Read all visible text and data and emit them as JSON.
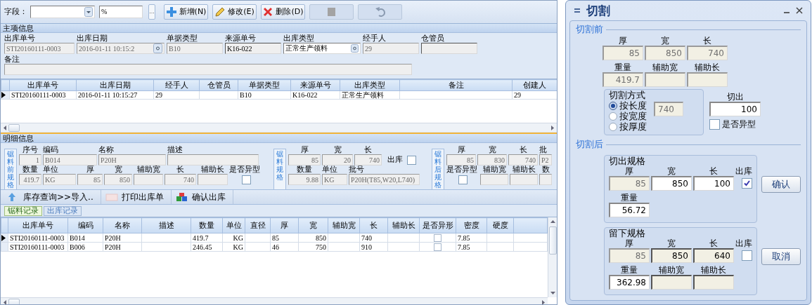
{
  "toolbar": {
    "label": "字段：",
    "filter_value": "%",
    "browse_button": "...",
    "buttons": [
      {
        "kind": "add",
        "label": "新增(N)",
        "disabled": false
      },
      {
        "kind": "edit",
        "label": "修改(E)",
        "disabled": false
      },
      {
        "kind": "delete",
        "label": "删除(D)",
        "disabled": false
      },
      {
        "kind": "save",
        "disabled": true
      },
      {
        "kind": "undo",
        "disabled": true
      }
    ]
  },
  "main_info": {
    "title": "主项信息",
    "fields": [
      {
        "label": "出库单号",
        "value": "STI20160111-0003",
        "kind": "text",
        "disabled": true,
        "editable": false
      },
      {
        "label": "出库日期",
        "value": "2016-01-11 10:15:2",
        "kind": "date",
        "disabled": true,
        "editable": false
      },
      {
        "label": "单据类型",
        "value": "B10",
        "kind": "text",
        "disabled": true,
        "editable": false
      },
      {
        "label": "来源单号",
        "value": "K16-022",
        "kind": "text",
        "disabled": false,
        "editable": false
      },
      {
        "label": "出库类型",
        "value": "正常生产领料",
        "kind": "combo",
        "disabled": false,
        "editable": true
      },
      {
        "label": "经手人",
        "value": "29",
        "kind": "text",
        "disabled": true,
        "editable": false
      },
      {
        "label": "仓管员",
        "kind": "text",
        "disabled": false,
        "editable": false
      }
    ],
    "remark": {
      "label": "备注",
      "kind": "text",
      "disabled": true,
      "editable": false
    }
  },
  "main_table": {
    "columns": [
      "出库单号",
      "出库日期",
      "经手人",
      "仓管员",
      "单据类型",
      "来源单号",
      "出库类型",
      "备注",
      "创建人"
    ],
    "rows": [
      {
        "selected": true,
        "cells": [
          "STI20160111-0003",
          "2016-01-11 10:15:27",
          "29",
          null,
          "B10",
          "K16-022",
          "正常生产领料",
          null,
          "29"
        ]
      }
    ]
  },
  "detail": {
    "title": "明细信息",
    "groups": [
      {
        "title": "锯料前规格",
        "fields": [
          {
            "label": "序号",
            "value": "1",
            "kind": "number",
            "disabled": true,
            "editable": false
          },
          {
            "label": "编码",
            "value": "B014",
            "kind": "text",
            "disabled": true,
            "editable": false
          },
          {
            "label": "名称",
            "value": "P20H",
            "kind": "text",
            "disabled": true,
            "editable": false
          },
          {
            "label": "描述",
            "kind": "text",
            "disabled": true,
            "editable": false
          },
          {
            "label": "数量",
            "value": "419.7",
            "kind": "number",
            "disabled": true,
            "editable": false
          },
          {
            "label": "单位",
            "value": "KG",
            "kind": "text",
            "disabled": true,
            "editable": false
          },
          {
            "label": "厚",
            "value": "85",
            "kind": "number",
            "disabled": true,
            "editable": false
          },
          {
            "label": "宽",
            "value": "850",
            "kind": "number",
            "disabled": true,
            "editable": false
          },
          {
            "label": "辅助宽",
            "kind": "number",
            "disabled": true,
            "editable": false
          },
          {
            "label": "长",
            "value": "740",
            "kind": "number",
            "disabled": true,
            "editable": false
          },
          {
            "label": "辅助长",
            "kind": "number",
            "disabled": true,
            "editable": false
          },
          {
            "label": "是否异型",
            "kind": "check",
            "checked": false
          }
        ]
      },
      {
        "title": "锯料规格",
        "fields": [
          {
            "label": "厚",
            "value": "85",
            "kind": "number",
            "disabled": true,
            "editable": false
          },
          {
            "label": "宽",
            "value": "20",
            "kind": "number",
            "disabled": true,
            "editable": false
          },
          {
            "label": "长",
            "value": "740",
            "kind": "number",
            "disabled": true,
            "editable": false
          },
          {
            "label": "出库",
            "kind": "inline_check",
            "checked": false
          },
          {
            "label": "数量",
            "value": "9.88",
            "kind": "number",
            "disabled": true,
            "editable": false
          },
          {
            "label": "单位",
            "value": "KG",
            "kind": "text",
            "disabled": true,
            "editable": false
          },
          {
            "label": "批号",
            "value": "P20H(T85,W20,L740)",
            "kind": "text",
            "disabled": true,
            "editable": false
          }
        ]
      },
      {
        "title": "锯料后规格",
        "fields": [
          {
            "label": "厚",
            "value": "85",
            "kind": "number",
            "disabled": true,
            "editable": false
          },
          {
            "label": "宽",
            "value": "830",
            "kind": "number",
            "disabled": true,
            "editable": false
          },
          {
            "label": "长",
            "value": "740",
            "kind": "number",
            "disabled": true,
            "editable": false
          },
          {
            "label": "批",
            "value": "P2",
            "kind": "text",
            "disabled": true,
            "editable": false
          },
          {
            "label": "是否异型",
            "kind": "check",
            "checked": false
          },
          {
            "label": "辅助宽",
            "kind": "number",
            "disabled": true,
            "editable": false
          },
          {
            "label": "辅助长",
            "kind": "number",
            "disabled": true,
            "editable": false
          },
          {
            "label": "数",
            "kind": "number",
            "disabled": true,
            "editable": false
          }
        ]
      }
    ],
    "actions": [
      {
        "kind": "import",
        "label": "库存查询>>导入.."
      },
      {
        "kind": "print",
        "label": "打印出库单"
      },
      {
        "kind": "confirm",
        "label": "确认出库"
      }
    ],
    "tabs": [
      {
        "label": "锯料记录",
        "selected": true
      },
      {
        "label": "出库记录",
        "selected": false
      }
    ]
  },
  "detail_table": {
    "columns": [
      "出库单号",
      "编码",
      "名称",
      "描述",
      "数量",
      "单位",
      "直径",
      "厚",
      "宽",
      "辅助宽",
      "长",
      "辅助长",
      "是否异形",
      "密度",
      "硬度"
    ],
    "rows": [
      {
        "selected": true,
        "cells": [
          "STI20160111-0003",
          "B014",
          "P20H",
          null,
          "419.7",
          "KG",
          null,
          "85",
          "850",
          null,
          "740",
          null,
          {
            "checked": false
          },
          "7.85",
          null
        ]
      },
      {
        "selected": false,
        "cells": [
          "STI20160111-0003",
          "B006",
          "P20H",
          null,
          "246.45",
          "KG",
          null,
          "46",
          "750",
          null,
          "910",
          null,
          {
            "checked": false
          },
          "7.85",
          null
        ]
      }
    ]
  },
  "dialog": {
    "title": "切割",
    "before": {
      "title": "切割前",
      "rows": [
        [
          {
            "label": "厚",
            "value": "85",
            "kind": "number",
            "disabled": true,
            "editable": false
          },
          {
            "label": "宽",
            "value": "850",
            "kind": "number",
            "disabled": true,
            "editable": false
          },
          {
            "label": "长",
            "value": "740",
            "kind": "number",
            "disabled": true,
            "editable": false
          }
        ],
        [
          {
            "label": "重量",
            "value": "419.7",
            "kind": "number",
            "disabled": true,
            "editable": false
          },
          {
            "label": "辅助宽",
            "kind": "number",
            "disabled": true,
            "editable": false
          },
          {
            "label": "辅助长",
            "kind": "number",
            "disabled": true,
            "editable": false
          }
        ]
      ]
    },
    "method": {
      "title": "切割方式",
      "options": [
        {
          "label": "按长度",
          "selected": true
        },
        {
          "label": "按宽度",
          "selected": false
        },
        {
          "label": "按厚度",
          "selected": false
        }
      ],
      "field": {
        "value": "740",
        "kind": "text",
        "disabled": true,
        "editable": false
      }
    },
    "cut": {
      "label": "切出",
      "value": "100",
      "kind": "number",
      "disabled": false,
      "editable": true
    },
    "irregular": {
      "label": "是否异型",
      "checked": false
    },
    "after": {
      "title": "切割后",
      "groups": [
        {
          "title": "切出规格",
          "button": "确认",
          "rows": [
            [
              {
                "label": "厚",
                "value": "85",
                "kind": "number",
                "disabled": true,
                "editable": false
              },
              {
                "label": "宽",
                "value": "850",
                "kind": "number",
                "disabled": false,
                "editable": true
              },
              {
                "label": "长",
                "value": "100",
                "kind": "number",
                "disabled": false,
                "editable": true
              },
              {
                "label": "出库",
                "kind": "check",
                "checked": true
              }
            ],
            [
              {
                "label": "重量",
                "value": "56.72",
                "kind": "number",
                "disabled": false,
                "editable": true
              }
            ]
          ]
        },
        {
          "title": "留下规格",
          "button": "取消",
          "rows": [
            [
              {
                "label": "厚",
                "value": "85",
                "kind": "number",
                "disabled": true,
                "editable": false
              },
              {
                "label": "宽",
                "value": "850",
                "kind": "number",
                "disabled": false,
                "editable": false
              },
              {
                "label": "长",
                "value": "640",
                "kind": "number",
                "disabled": false,
                "editable": false
              },
              {
                "label": "出库",
                "kind": "check",
                "checked": false
              }
            ],
            [
              {
                "label": "重量",
                "value": "362.98",
                "kind": "number",
                "disabled": false,
                "editable": true
              },
              {
                "label": "辅助宽",
                "kind": "number",
                "disabled": false,
                "editable": false
              },
              {
                "label": "辅助长",
                "kind": "number",
                "disabled": false,
                "editable": false
              }
            ]
          ]
        }
      ]
    }
  }
}
